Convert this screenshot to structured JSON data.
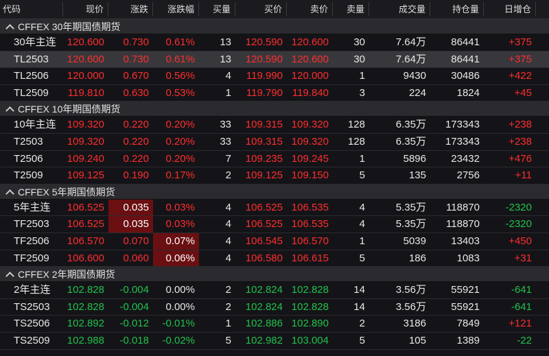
{
  "columns": [
    "代码",
    "现价",
    "涨跌",
    "涨跌幅",
    "买量",
    "买价",
    "卖价",
    "卖量",
    "成交量",
    "持仓量",
    "日增仓"
  ],
  "colors": {
    "up": "#ff2d2d",
    "down": "#21c14b",
    "flash": "#6a0f12"
  },
  "icons": {
    "group_toggle": "chevron-up-icon"
  },
  "selected_row": "TL2503",
  "groups": [
    {
      "title": "CFFEX 30年期国债期货",
      "rows": [
        {
          "code": "30年主连",
          "price": "120.600",
          "chg": "0.730",
          "pct": "0.61%",
          "bid_vol": "13",
          "bid": "120.590",
          "ask": "120.600",
          "ask_vol": "30",
          "volume": "7.64万",
          "oi": "86441",
          "oi_chg": "+375",
          "dir": "up"
        },
        {
          "code": "TL2503",
          "price": "120.600",
          "chg": "0.730",
          "pct": "0.61%",
          "bid_vol": "13",
          "bid": "120.590",
          "ask": "120.600",
          "ask_vol": "30",
          "volume": "7.64万",
          "oi": "86441",
          "oi_chg": "+375",
          "dir": "up"
        },
        {
          "code": "TL2506",
          "price": "120.000",
          "chg": "0.670",
          "pct": "0.56%",
          "bid_vol": "4",
          "bid": "119.990",
          "ask": "120.000",
          "ask_vol": "1",
          "volume": "9430",
          "oi": "30486",
          "oi_chg": "+422",
          "dir": "up"
        },
        {
          "code": "TL2509",
          "price": "119.810",
          "chg": "0.630",
          "pct": "0.53%",
          "bid_vol": "1",
          "bid": "119.790",
          "ask": "119.840",
          "ask_vol": "3",
          "volume": "224",
          "oi": "1824",
          "oi_chg": "+45",
          "dir": "up"
        }
      ]
    },
    {
      "title": "CFFEX 10年期国债期货",
      "rows": [
        {
          "code": "10年主连",
          "price": "109.320",
          "chg": "0.220",
          "pct": "0.20%",
          "bid_vol": "33",
          "bid": "109.315",
          "ask": "109.320",
          "ask_vol": "128",
          "volume": "6.35万",
          "oi": "173343",
          "oi_chg": "+238",
          "dir": "up"
        },
        {
          "code": "T2503",
          "price": "109.320",
          "chg": "0.220",
          "pct": "0.20%",
          "bid_vol": "33",
          "bid": "109.315",
          "ask": "109.320",
          "ask_vol": "128",
          "volume": "6.35万",
          "oi": "173343",
          "oi_chg": "+238",
          "dir": "up"
        },
        {
          "code": "T2506",
          "price": "109.240",
          "chg": "0.220",
          "pct": "0.20%",
          "bid_vol": "7",
          "bid": "109.235",
          "ask": "109.245",
          "ask_vol": "1",
          "volume": "5896",
          "oi": "23432",
          "oi_chg": "+476",
          "dir": "up"
        },
        {
          "code": "T2509",
          "price": "109.125",
          "chg": "0.190",
          "pct": "0.17%",
          "bid_vol": "2",
          "bid": "109.125",
          "ask": "109.150",
          "ask_vol": "5",
          "volume": "135",
          "oi": "2756",
          "oi_chg": "+11",
          "dir": "up"
        }
      ]
    },
    {
      "title": "CFFEX 5年期国债期货",
      "rows": [
        {
          "code": "5年主连",
          "price": "106.525",
          "chg": "0.035",
          "pct": "0.03%",
          "bid_vol": "4",
          "bid": "106.525",
          "ask": "106.535",
          "ask_vol": "4",
          "volume": "5.35万",
          "oi": "118870",
          "oi_chg": "-2320",
          "dir": "up",
          "flash": "chg"
        },
        {
          "code": "TF2503",
          "price": "106.525",
          "chg": "0.035",
          "pct": "0.03%",
          "bid_vol": "4",
          "bid": "106.525",
          "ask": "106.535",
          "ask_vol": "4",
          "volume": "5.35万",
          "oi": "118870",
          "oi_chg": "-2320",
          "dir": "up",
          "flash": "chg"
        },
        {
          "code": "TF2506",
          "price": "106.570",
          "chg": "0.070",
          "pct": "0.07%",
          "bid_vol": "4",
          "bid": "106.545",
          "ask": "106.570",
          "ask_vol": "1",
          "volume": "5039",
          "oi": "13403",
          "oi_chg": "+450",
          "dir": "up",
          "flash": "pct"
        },
        {
          "code": "TF2509",
          "price": "106.600",
          "chg": "0.060",
          "pct": "0.06%",
          "bid_vol": "4",
          "bid": "106.580",
          "ask": "106.615",
          "ask_vol": "5",
          "volume": "186",
          "oi": "1083",
          "oi_chg": "+31",
          "dir": "up",
          "flash": "pct"
        }
      ]
    },
    {
      "title": "CFFEX 2年期国债期货",
      "rows": [
        {
          "code": "2年主连",
          "price": "102.828",
          "chg": "-0.004",
          "pct": "0.00%",
          "bid_vol": "2",
          "bid": "102.824",
          "ask": "102.828",
          "ask_vol": "14",
          "volume": "3.56万",
          "oi": "55921",
          "oi_chg": "-641",
          "dir": "down"
        },
        {
          "code": "TS2503",
          "price": "102.828",
          "chg": "-0.004",
          "pct": "0.00%",
          "bid_vol": "2",
          "bid": "102.824",
          "ask": "102.828",
          "ask_vol": "14",
          "volume": "3.56万",
          "oi": "55921",
          "oi_chg": "-641",
          "dir": "down"
        },
        {
          "code": "TS2506",
          "price": "102.892",
          "chg": "-0.012",
          "pct": "-0.01%",
          "bid_vol": "1",
          "bid": "102.886",
          "ask": "102.890",
          "ask_vol": "2",
          "volume": "3186",
          "oi": "7849",
          "oi_chg": "+121",
          "dir": "down"
        },
        {
          "code": "TS2509",
          "price": "102.988",
          "chg": "-0.018",
          "pct": "-0.02%",
          "bid_vol": "5",
          "bid": "102.982",
          "ask": "103.004",
          "ask_vol": "5",
          "volume": "105",
          "oi": "1389",
          "oi_chg": "-22",
          "dir": "down"
        }
      ]
    }
  ]
}
